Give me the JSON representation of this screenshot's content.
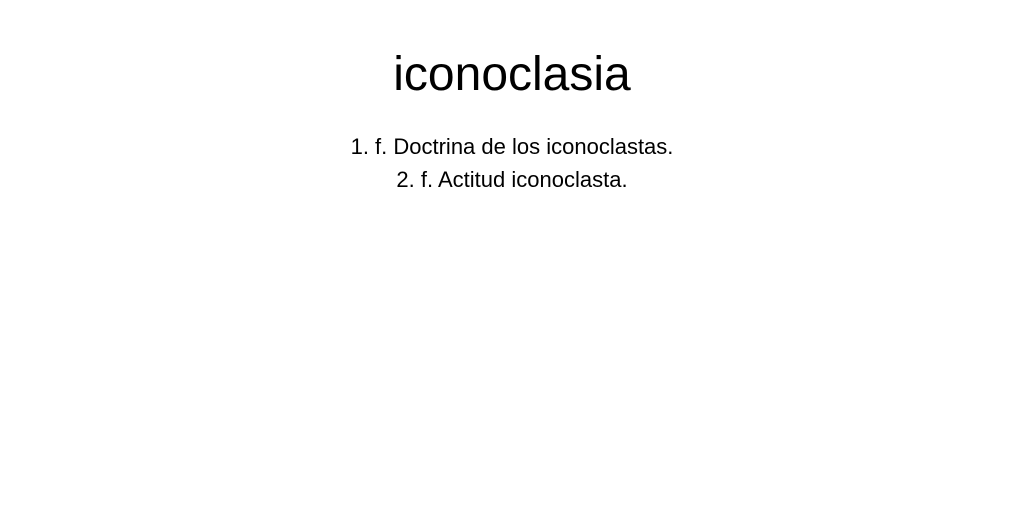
{
  "entry": {
    "word": "iconoclasia",
    "definitions": [
      "1. f. Doctrina de los iconoclastas.",
      "2. f. Actitud iconoclasta."
    ]
  }
}
